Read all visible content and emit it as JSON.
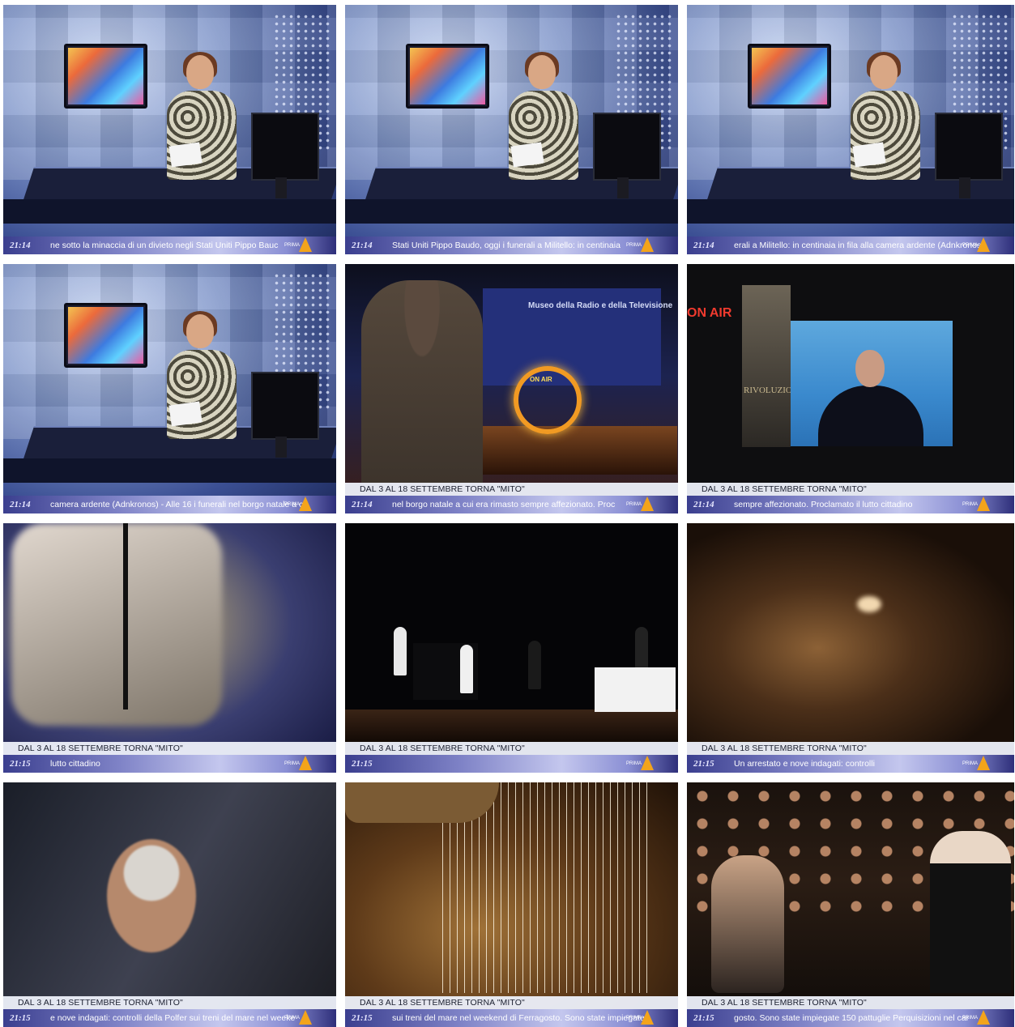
{
  "frames": [
    {
      "scene": "studio",
      "caption": "",
      "time": "21:14",
      "ticker": "ne sotto la minaccia di un divieto negli Stati Uniti        Pippo Bauc",
      "logo": "PRIMA"
    },
    {
      "scene": "studio",
      "caption": "",
      "time": "21:14",
      "ticker": "Stati Uniti        Pippo Baudo, oggi i funerali a Militello: in centinaia",
      "logo": "PRIMA"
    },
    {
      "scene": "studio",
      "caption": "",
      "time": "21:14",
      "ticker": "erali a Militello: in centinaia in fila alla camera ardente  (Adnkronos)",
      "logo": "PRIMA"
    },
    {
      "scene": "studio",
      "caption": "",
      "time": "21:14",
      "ticker": "camera ardente  (Adnkronos) - Alle 16 i funerali nel borgo natale a c",
      "logo": "PRIMA"
    },
    {
      "scene": "museo",
      "caption": "DAL 3 AL 18 SETTEMBRE TORNA \"MITO\"",
      "time": "21:14",
      "ticker": "nel borgo natale a cui era rimasto sempre affezionato. Proc",
      "logo": "PRIMA"
    },
    {
      "scene": "mayor",
      "caption": "DAL 3 AL 18 SETTEMBRE TORNA \"MITO\"",
      "time": "21:14",
      "ticker": "sempre affezionato. Proclamato il lutto cittadino",
      "logo": "PRIMA"
    },
    {
      "scene": "blur1",
      "caption": "DAL 3 AL 18 SETTEMBRE TORNA \"MITO\"",
      "time": "21:15",
      "ticker": "  lutto cittadino",
      "logo": "PRIMA"
    },
    {
      "scene": "stagewide",
      "caption": "DAL 3 AL 18 SETTEMBRE TORNA \"MITO\"",
      "time": "21:15",
      "ticker": "",
      "logo": "PRIMA"
    },
    {
      "scene": "orch1",
      "caption": "DAL 3 AL 18 SETTEMBRE TORNA \"MITO\"",
      "time": "21:15",
      "ticker": "                                          Un arrestato e nove indagati: controlli",
      "logo": "PRIMA"
    },
    {
      "scene": "orch2",
      "caption": "DAL 3 AL 18 SETTEMBRE TORNA \"MITO\"",
      "time": "21:15",
      "ticker": "e nove indagati: controlli della Polfer sui treni del mare nel weeke",
      "logo": "PRIMA"
    },
    {
      "scene": "harp",
      "caption": "DAL 3 AL 18 SETTEMBRE TORNA \"MITO\"",
      "time": "21:15",
      "ticker": "sui treni del mare nel weekend di Ferragosto. Sono state impiegate",
      "logo": "PRIMA"
    },
    {
      "scene": "concert",
      "caption": "DAL 3 AL 18 SETTEMBRE TORNA \"MITO\"",
      "time": "21:15",
      "ticker": "gosto. Sono state impiegate 150 pattuglie        Perquisizioni nel car",
      "logo": "PRIMA"
    }
  ],
  "scene_text": {
    "onair": "ON AIR",
    "museo": "Museo della Radio e della Televisione",
    "rivoluzione": "RIVOLUZIO"
  }
}
